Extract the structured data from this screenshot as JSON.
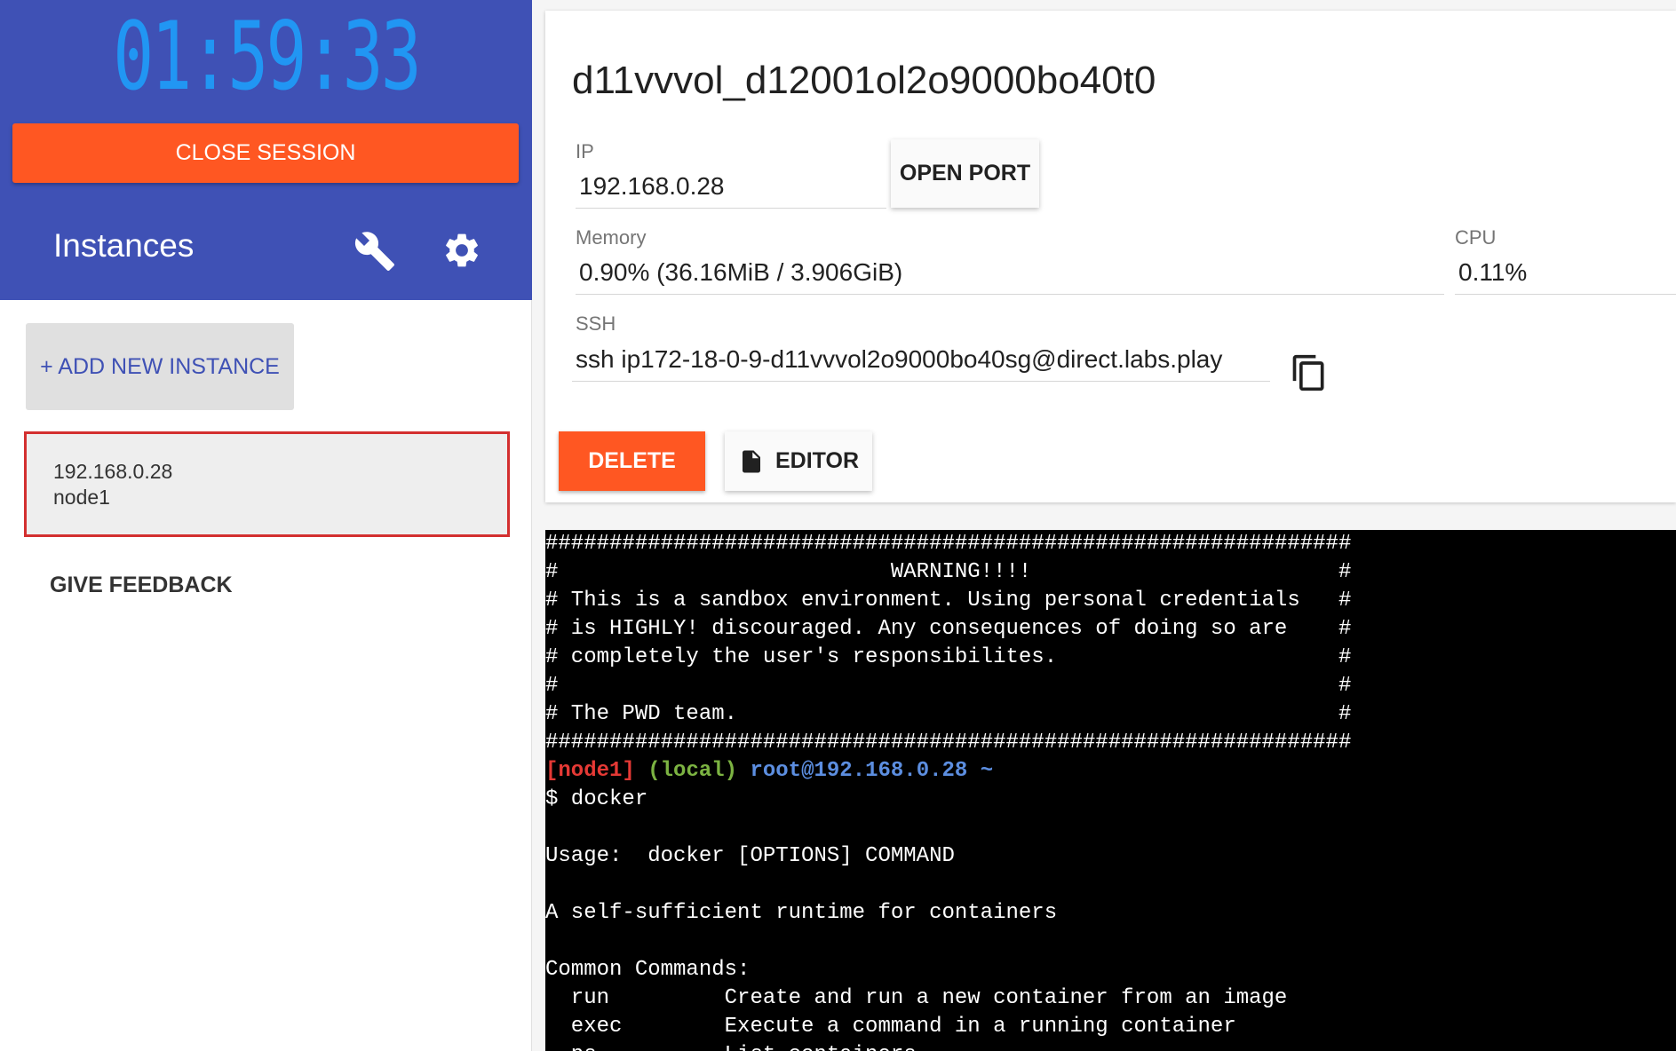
{
  "sidebar": {
    "timer": "01:59:33",
    "close_session": "CLOSE SESSION",
    "instances_title": "Instances",
    "add_instance": "+ ADD NEW INSTANCE",
    "instance": {
      "ip": "192.168.0.28",
      "name": "node1"
    },
    "feedback": "GIVE FEEDBACK"
  },
  "panel": {
    "title": "d11vvvol_d12001ol2o9000bo40t0",
    "ip_label": "IP",
    "ip_value": "192.168.0.28",
    "open_port": "OPEN PORT",
    "memory_label": "Memory",
    "memory_value": "0.90% (36.16MiB / 3.906GiB)",
    "cpu_label": "CPU",
    "cpu_value": "0.11%",
    "ssh_label": "SSH",
    "ssh_value": "ssh ip172-18-0-9-d11vvvol2o9000bo40sg@direct.labs.play",
    "delete": "DELETE",
    "editor": "EDITOR"
  },
  "terminal": {
    "lines": [
      "###############################################################",
      "#                          WARNING!!!!                        #",
      "# This is a sandbox environment. Using personal credentials   #",
      "# is HIGHLY! discouraged. Any consequences of doing so are    #",
      "# completely the user's responsibilites.                      #",
      "#                                                             #",
      "# The PWD team.                                               #",
      "###############################################################"
    ],
    "prompt_node": "[node1]",
    "prompt_local": "(local)",
    "prompt_user": "root@192.168.0.28 ~",
    "command_line": "$ docker",
    "output": [
      "",
      "Usage:  docker [OPTIONS] COMMAND",
      "",
      "A self-sufficient runtime for containers",
      "",
      "Common Commands:",
      "  run         Create and run a new container from an image",
      "  exec        Execute a command in a running container",
      "  ps          List containers"
    ]
  },
  "colors": {
    "sidebar_header": "#3f51b5",
    "timer": "#2196f3",
    "accent_orange": "#ff5722",
    "selected_border": "#d32f2f"
  }
}
